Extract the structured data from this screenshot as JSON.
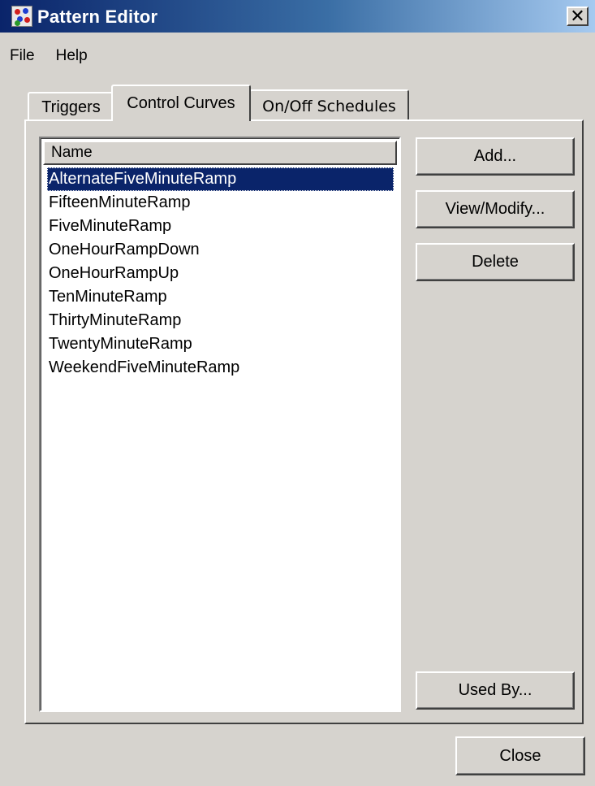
{
  "window": {
    "title": "Pattern Editor",
    "close_glyph": "✕"
  },
  "menu": {
    "items": [
      "File",
      "Help"
    ]
  },
  "tabs": [
    {
      "label": "Triggers",
      "active": false
    },
    {
      "label": "Control Curves",
      "active": true
    },
    {
      "label": "On/Off Schedules",
      "active": false
    }
  ],
  "list": {
    "header": "Name",
    "selected_index": 0,
    "items": [
      "AlternateFiveMinuteRamp",
      "FifteenMinuteRamp",
      "FiveMinuteRamp",
      "OneHourRampDown",
      "OneHourRampUp",
      "TenMinuteRamp",
      "ThirtyMinuteRamp",
      "TwentyMinuteRamp",
      "WeekendFiveMinuteRamp"
    ]
  },
  "buttons": {
    "add": "Add...",
    "view_modify": "View/Modify...",
    "delete": "Delete",
    "used_by": "Used By...",
    "close": "Close"
  },
  "colors": {
    "title_bar_start": "#0a246a",
    "title_bar_end": "#a6caf0",
    "selection": "#0a246a",
    "face": "#d6d3ce"
  },
  "icons": {
    "app": "pattern-editor-app-icon",
    "close": "close-icon"
  }
}
